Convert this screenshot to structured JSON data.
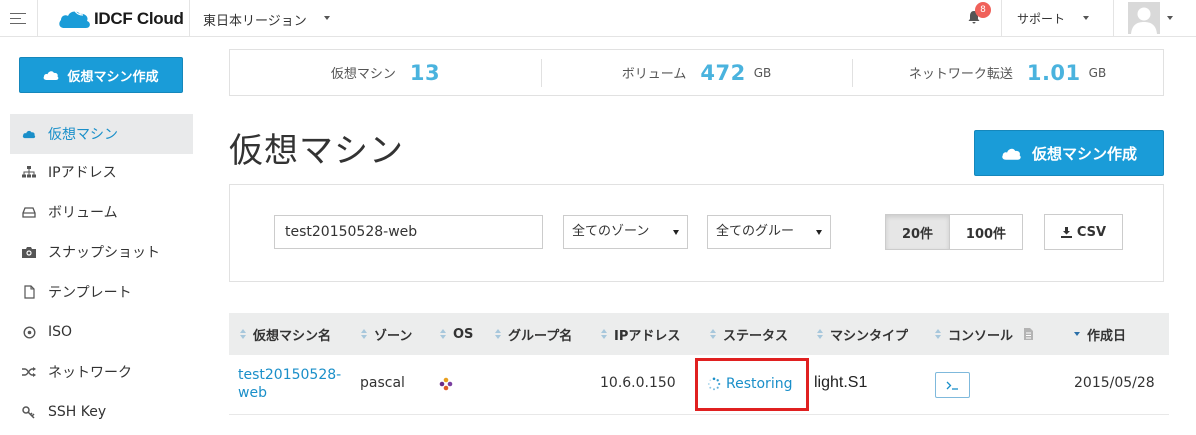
{
  "topbar": {
    "brand": "IDCF Cloud",
    "region": "東日本リージョン",
    "notification_count": "8",
    "support_label": "サポート"
  },
  "sidebar": {
    "create_button": "仮想マシン作成",
    "items": [
      {
        "label": "仮想マシン",
        "icon": "cloud-icon",
        "active": true
      },
      {
        "label": "IPアドレス",
        "icon": "sitemap-icon"
      },
      {
        "label": "ボリューム",
        "icon": "hdd-icon"
      },
      {
        "label": "スナップショット",
        "icon": "camera-icon"
      },
      {
        "label": "テンプレート",
        "icon": "file-icon"
      },
      {
        "label": "ISO",
        "icon": "disc-icon"
      },
      {
        "label": "ネットワーク",
        "icon": "shuffle-icon"
      },
      {
        "label": "SSH Key",
        "icon": "key-icon"
      }
    ]
  },
  "stats": [
    {
      "label": "仮想マシン",
      "value": "13",
      "unit": ""
    },
    {
      "label": "ボリューム",
      "value": "472",
      "unit": "GB"
    },
    {
      "label": "ネットワーク転送",
      "value": "1.01",
      "unit": "GB"
    }
  ],
  "main": {
    "title": "仮想マシン",
    "create_button": "仮想マシン作成"
  },
  "filters": {
    "search_value": "test20150528-web",
    "zone_select": "全てのゾーン",
    "group_select": "全てのグルー",
    "page_sizes": [
      "20件",
      "100件"
    ],
    "page_size_selected": "20件",
    "csv_label": "CSV"
  },
  "table": {
    "columns": [
      "仮想マシン名",
      "ゾーン",
      "OS",
      "グループ名",
      "IPアドレス",
      "ステータス",
      "マシンタイプ",
      "コンソール",
      "作成日"
    ],
    "rows": [
      {
        "name_line1": "test20150528-",
        "name_line2": "web",
        "zone": "pascal",
        "os_icon": "os-logo-icon",
        "group": "",
        "ip": "10.6.0.150",
        "status": "Restoring",
        "machine_type": "light.S1",
        "console_icon": "terminal-icon",
        "created": "2015/05/28"
      }
    ]
  },
  "colors": {
    "accent": "#1a9cd8",
    "link": "#1a8fc9",
    "stat_number": "#4ab3de",
    "highlight_box": "#e02020",
    "badge": "#f0615a"
  }
}
